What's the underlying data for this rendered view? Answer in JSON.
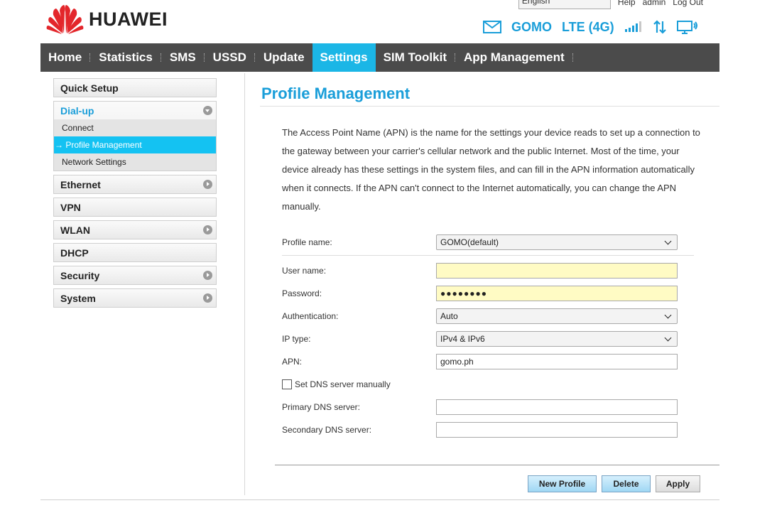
{
  "brand": {
    "name": "HUAWEI",
    "logo_color": "#e3262b"
  },
  "topbar": {
    "language": "English",
    "help": "Help",
    "user": "admin",
    "logout": "Log Out"
  },
  "status": {
    "operator": "GOMO",
    "network": "LTE (4G)",
    "accent": "#1a9ed9"
  },
  "nav": [
    {
      "label": "Home"
    },
    {
      "label": "Statistics"
    },
    {
      "label": "SMS"
    },
    {
      "label": "USSD"
    },
    {
      "label": "Update"
    },
    {
      "label": "Settings",
      "active": true
    },
    {
      "label": "SIM Toolkit"
    },
    {
      "label": "App Management"
    }
  ],
  "sidebar": {
    "quick_setup": "Quick Setup",
    "dialup": {
      "label": "Dial-up",
      "items": [
        "Connect",
        "→ Profile Management",
        "Network Settings"
      ]
    },
    "ethernet": "Ethernet",
    "vpn": "VPN",
    "wlan": "WLAN",
    "dhcp": "DHCP",
    "security": "Security",
    "system": "System"
  },
  "page": {
    "title": "Profile Management",
    "description": "The Access Point Name (APN) is the name for the settings your device reads to set up a connection to the gateway between your carrier's cellular network and the public Internet. Most of the time, your device already has these settings in the system files, and can fill in the APN information automatically when it connects. If the APN can't connect to the Internet automatically, you can change the APN manually."
  },
  "form": {
    "profile_name_label": "Profile name:",
    "profile_name_value": "GOMO(default)",
    "username_label": "User name:",
    "username_value": "",
    "password_label": "Password:",
    "password_value": "●●●●●●●●",
    "auth_label": "Authentication:",
    "auth_value": "Auto",
    "iptype_label": "IP type:",
    "iptype_value": "IPv4 & IPv6",
    "apn_label": "APN:",
    "apn_value": "gomo.ph",
    "dns_checkbox_label": "Set DNS server manually",
    "primary_dns_label": "Primary DNS server:",
    "primary_dns_value": "",
    "secondary_dns_label": "Secondary DNS server:",
    "secondary_dns_value": ""
  },
  "buttons": {
    "new_profile": "New Profile",
    "delete": "Delete",
    "apply": "Apply"
  }
}
